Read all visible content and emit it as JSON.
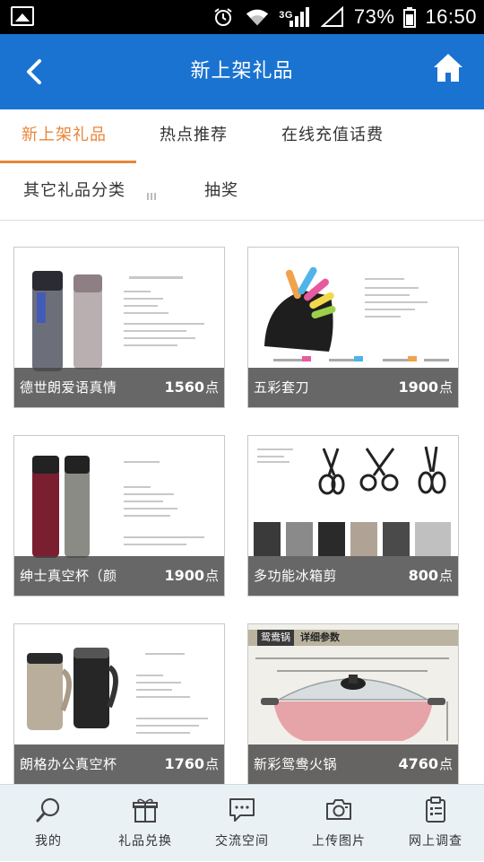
{
  "status_bar": {
    "network": "3G",
    "battery": "73%",
    "time": "16:50"
  },
  "header": {
    "title": "新上架礼品"
  },
  "tabs": [
    {
      "label": "新上架礼品",
      "active": true
    },
    {
      "label": "热点推荐"
    },
    {
      "label": "在线充值话费"
    },
    {
      "label": "其它礼品分类"
    },
    {
      "label": "抽奖"
    }
  ],
  "products": [
    {
      "name": "德世朗爱语真情",
      "points": "1560",
      "unit": "点"
    },
    {
      "name": "五彩套刀",
      "points": "1900",
      "unit": "点"
    },
    {
      "name": "绅士真空杯（颜",
      "points": "1900",
      "unit": "点"
    },
    {
      "name": "多功能冰箱剪",
      "points": "800",
      "unit": "点"
    },
    {
      "name": "朗格办公真空杯",
      "points": "1760",
      "unit": "点"
    },
    {
      "name": "新彩鸳鸯火锅",
      "points": "4760",
      "unit": "点"
    }
  ],
  "pot_image_banner": {
    "left": "鸳鸯锅",
    "right": "详细参数"
  },
  "bottom_nav": [
    {
      "label": "我的",
      "icon": "search-icon"
    },
    {
      "label": "礼品兑换",
      "icon": "gift-icon"
    },
    {
      "label": "交流空间",
      "icon": "chat-icon"
    },
    {
      "label": "上传图片",
      "icon": "camera-icon"
    },
    {
      "label": "网上调查",
      "icon": "clipboard-icon"
    }
  ],
  "colors": {
    "header": "#1a73d0",
    "accent": "#e8863a",
    "nav_bg": "#e9f1f5"
  }
}
